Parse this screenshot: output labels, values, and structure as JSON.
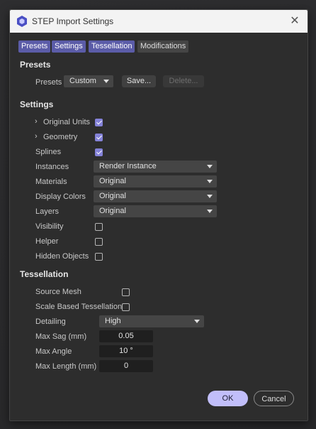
{
  "window": {
    "title": "STEP Import Settings",
    "close_icon": "close-icon",
    "app_icon": "hexagon-cube-icon"
  },
  "tabs": [
    {
      "label": "Presets",
      "active": true
    },
    {
      "label": "Settings",
      "active": true
    },
    {
      "label": "Tessellation",
      "active": true
    },
    {
      "label": "Modifications",
      "active": false
    }
  ],
  "presets": {
    "heading": "Presets",
    "label": "Presets",
    "value": "Custom",
    "save_label": "Save...",
    "delete_label": "Delete..."
  },
  "settings": {
    "heading": "Settings",
    "original_units": {
      "label": "Original Units",
      "checked": true
    },
    "geometry": {
      "label": "Geometry",
      "checked": true
    },
    "splines": {
      "label": "Splines",
      "checked": true
    },
    "instances": {
      "label": "Instances",
      "value": "Render Instance"
    },
    "materials": {
      "label": "Materials",
      "value": "Original"
    },
    "display_colors": {
      "label": "Display Colors",
      "value": "Original"
    },
    "layers": {
      "label": "Layers",
      "value": "Original"
    },
    "visibility": {
      "label": "Visibility",
      "checked": false
    },
    "helper": {
      "label": "Helper",
      "checked": false
    },
    "hidden_objects": {
      "label": "Hidden Objects",
      "checked": false
    }
  },
  "tessellation": {
    "heading": "Tessellation",
    "source_mesh": {
      "label": "Source Mesh",
      "checked": false
    },
    "scale_based": {
      "label": "Scale Based Tessellation",
      "checked": false
    },
    "detailing": {
      "label": "Detailing",
      "value": "High"
    },
    "max_sag": {
      "label": "Max Sag (mm)",
      "value": "0.05"
    },
    "max_angle": {
      "label": "Max Angle",
      "value": "10 °"
    },
    "max_length": {
      "label": "Max Length (mm)",
      "value": "0"
    }
  },
  "footer": {
    "ok_label": "OK",
    "cancel_label": "Cancel"
  },
  "colors": {
    "accent": "#5b5ca8",
    "ok_button": "#c1befa",
    "checkbox": "#8482d8"
  }
}
